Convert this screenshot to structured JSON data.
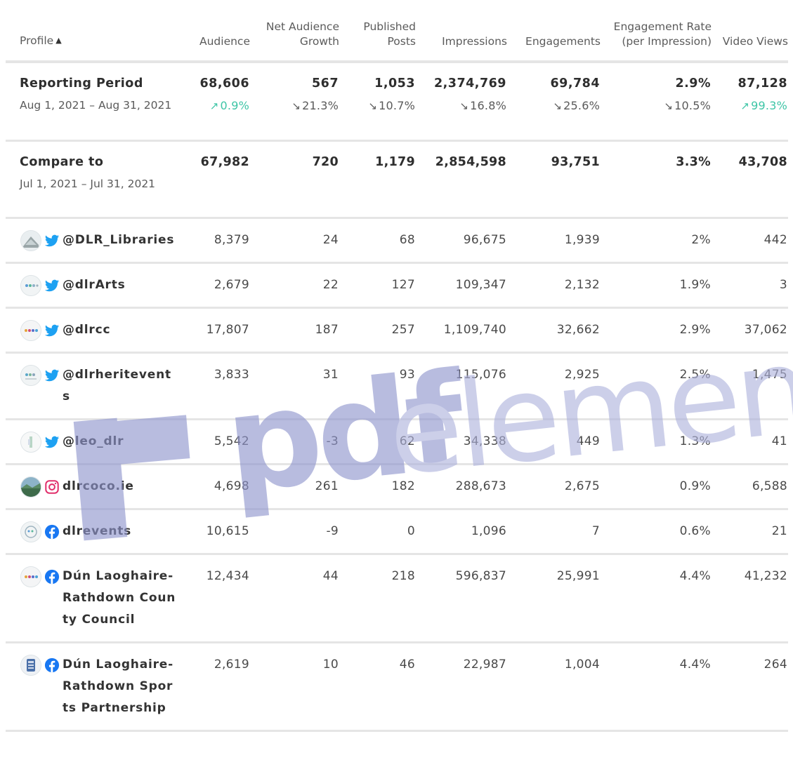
{
  "header": {
    "profile": "Profile",
    "audience": "Audience",
    "net_audience_growth": "Net Audience Growth",
    "published_posts": "Published Posts",
    "impressions": "Impressions",
    "engagements": "Engagements",
    "engagement_rate": "Engagement Rate (per Impression)",
    "video_views": "Video Views"
  },
  "reporting_period": {
    "label": "Reporting Period",
    "range": "Aug 1, 2021 – Aug 31, 2021",
    "audience": {
      "value": "68,606",
      "delta": "0.9%",
      "dir": "up"
    },
    "net_audience_growth": {
      "value": "567",
      "delta": "21.3%",
      "dir": "down"
    },
    "published_posts": {
      "value": "1,053",
      "delta": "10.7%",
      "dir": "down"
    },
    "impressions": {
      "value": "2,374,769",
      "delta": "16.8%",
      "dir": "down"
    },
    "engagements": {
      "value": "69,784",
      "delta": "25.6%",
      "dir": "down"
    },
    "engagement_rate": {
      "value": "2.9%",
      "delta": "10.5%",
      "dir": "down"
    },
    "video_views": {
      "value": "87,128",
      "delta": "99.3%",
      "dir": "up"
    }
  },
  "compare_to": {
    "label": "Compare to",
    "range": "Jul 1, 2021 – Jul 31, 2021",
    "audience": "67,982",
    "net_audience_growth": "720",
    "published_posts": "1,179",
    "impressions": "2,854,598",
    "engagements": "93,751",
    "engagement_rate": "3.3%",
    "video_views": "43,708"
  },
  "profiles": [
    {
      "name": "@DLR_Libraries",
      "network": "twitter",
      "avatar": "library-avatar",
      "audience": "8,379",
      "net_audience_growth": "24",
      "published_posts": "68",
      "impressions": "96,675",
      "engagements": "1,939",
      "engagement_rate": "2%",
      "video_views": "442"
    },
    {
      "name": "@dlrArts",
      "network": "twitter",
      "avatar": "arts-avatar",
      "audience": "2,679",
      "net_audience_growth": "22",
      "published_posts": "127",
      "impressions": "109,347",
      "engagements": "2,132",
      "engagement_rate": "1.9%",
      "video_views": "3"
    },
    {
      "name": "@dlrcc",
      "network": "twitter",
      "avatar": "council-avatar",
      "audience": "17,807",
      "net_audience_growth": "187",
      "published_posts": "257",
      "impressions": "1,109,740",
      "engagements": "32,662",
      "engagement_rate": "2.9%",
      "video_views": "37,062"
    },
    {
      "name": "@dlrheritevents",
      "network": "twitter",
      "avatar": "heritage-avatar",
      "audience": "3,833",
      "net_audience_growth": "31",
      "published_posts": "93",
      "impressions": "115,076",
      "engagements": "2,925",
      "engagement_rate": "2.5%",
      "video_views": "1,475"
    },
    {
      "name": "@leo_dlr",
      "network": "twitter",
      "avatar": "leo-avatar",
      "audience": "5,542",
      "net_audience_growth": "-3",
      "published_posts": "62",
      "impressions": "34,338",
      "engagements": "449",
      "engagement_rate": "1.3%",
      "video_views": "41"
    },
    {
      "name": "dlrcoco.ie",
      "network": "instagram",
      "avatar": "landscape-avatar",
      "audience": "4,698",
      "net_audience_growth": "261",
      "published_posts": "182",
      "impressions": "288,673",
      "engagements": "2,675",
      "engagement_rate": "0.9%",
      "video_views": "6,588"
    },
    {
      "name": "dlrevents",
      "network": "facebook",
      "avatar": "events-avatar",
      "audience": "10,615",
      "net_audience_growth": "-9",
      "published_posts": "0",
      "impressions": "1,096",
      "engagements": "7",
      "engagement_rate": "0.6%",
      "video_views": "21"
    },
    {
      "name": "Dún Laoghaire-Rathdown County Council",
      "network": "facebook",
      "avatar": "council-avatar",
      "audience": "12,434",
      "net_audience_growth": "44",
      "published_posts": "218",
      "impressions": "596,837",
      "engagements": "25,991",
      "engagement_rate": "4.4%",
      "video_views": "41,232"
    },
    {
      "name": "Dún Laoghaire-Rathdown Sports Partnership",
      "network": "facebook",
      "avatar": "sports-avatar",
      "audience": "2,619",
      "net_audience_growth": "10",
      "published_posts": "46",
      "impressions": "22,987",
      "engagements": "1,004",
      "engagement_rate": "4.4%",
      "video_views": "264"
    }
  ],
  "watermark": {
    "brand": "pdf",
    "suffix": "element",
    "color": "#8e94cd"
  },
  "colors": {
    "up": "#3ec5a6",
    "down": "#5a5a5a",
    "twitter": "#1da1f2",
    "facebook": "#1877f2",
    "instagram": "#e1306c",
    "divider": "#e5e5e5"
  }
}
